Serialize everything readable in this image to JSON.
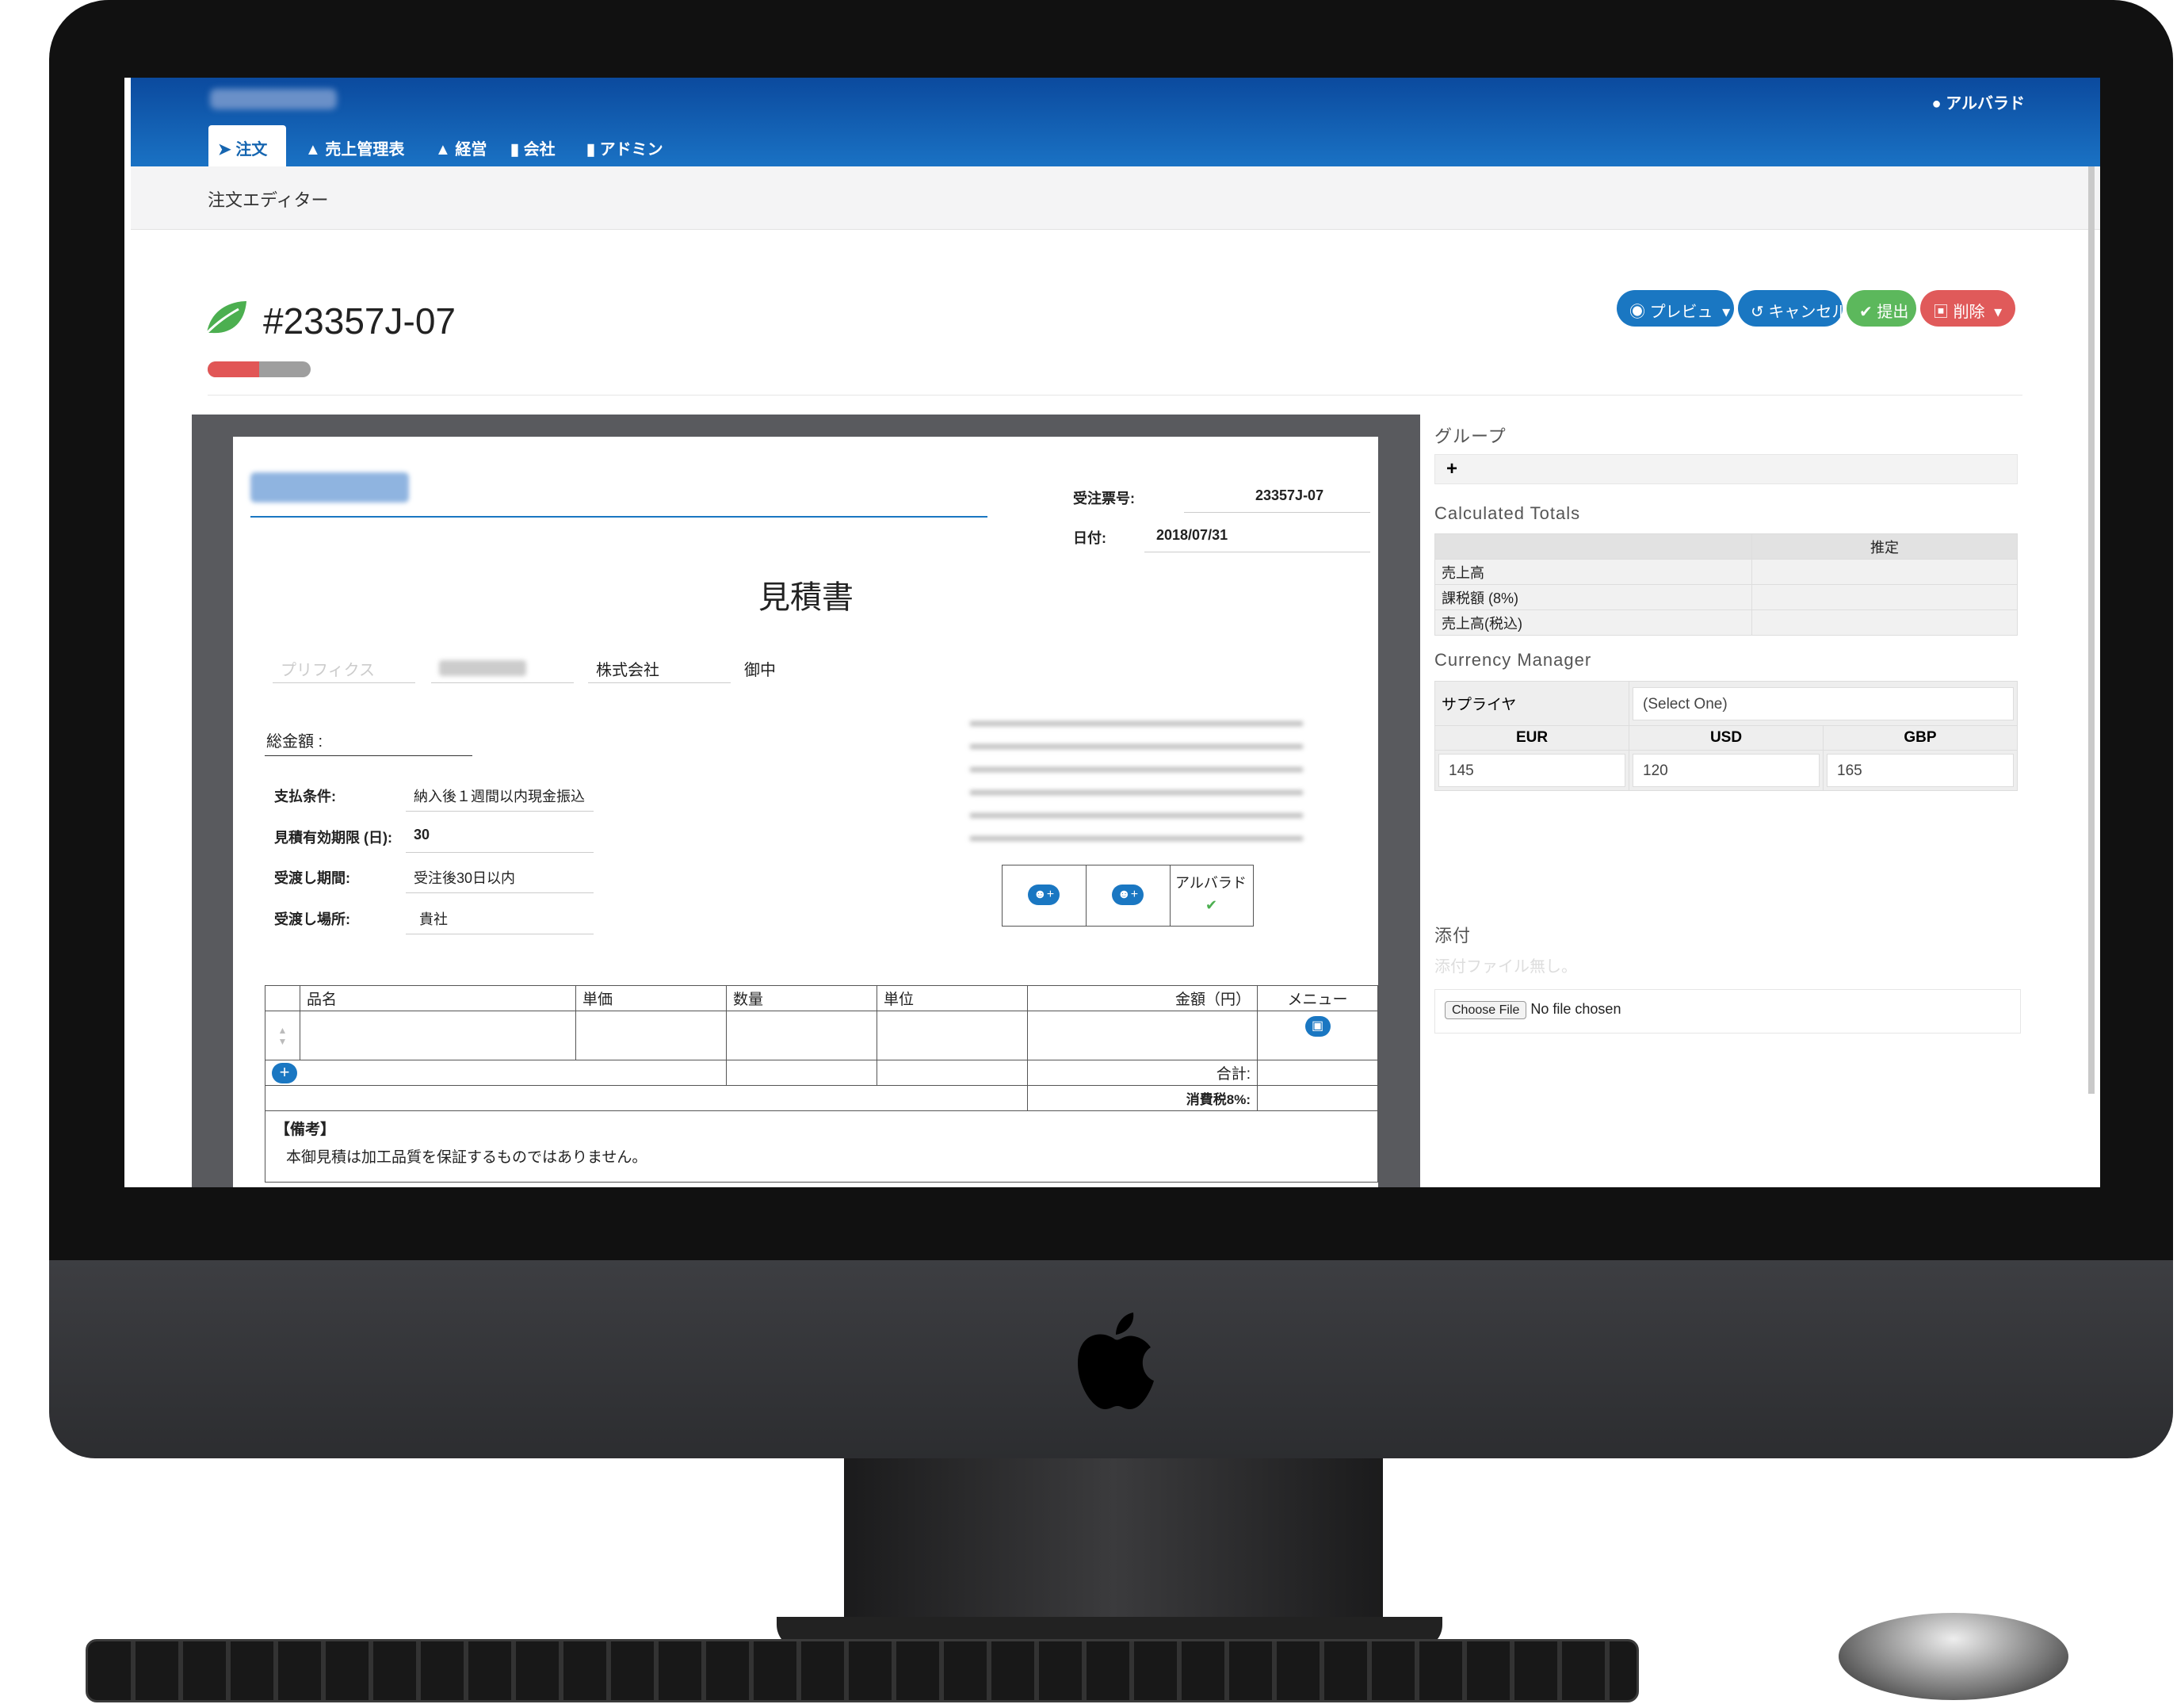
{
  "app": {
    "user": "アルバラド"
  },
  "nav": {
    "tabs": [
      {
        "label": "注文",
        "icon": "paper-plane-icon"
      },
      {
        "label": "売上管理表",
        "icon": "chart-icon"
      },
      {
        "label": "経営",
        "icon": "sitemap-icon"
      },
      {
        "label": "会社",
        "icon": "building-icon"
      },
      {
        "label": "アドミン",
        "icon": "database-icon"
      }
    ]
  },
  "breadcrumb": "注文エディター",
  "order": {
    "number": "#23357J-07",
    "progress": 0.5,
    "status_color": "#4caf50"
  },
  "actions": {
    "preview": "プレビュ",
    "cancel": "キャンセル",
    "submit": "提出",
    "delete": "削除"
  },
  "doc": {
    "order_no_label": "受注票号:",
    "order_no": "23357J-07",
    "date_label": "日付:",
    "date": "2018/07/31",
    "title": "見積書",
    "prefix_placeholder": "プリフィクス",
    "company_suffix": "株式会社",
    "honorific": "御中",
    "total_label": "総金額 :",
    "terms": [
      {
        "label": "支払条件:",
        "value": "納入後１週間以内現金振込"
      },
      {
        "label": "見積有効期限 (日):",
        "value": "30"
      },
      {
        "label": "受渡し期間:",
        "value": "受注後30日以内"
      },
      {
        "label": "受渡し場所:",
        "value": "貴社"
      }
    ],
    "approver": "アルバラド",
    "table_headers": [
      "品名",
      "単価",
      "数量",
      "単位",
      "金額（円）",
      "メニュー"
    ],
    "subtotal_label": "合計:",
    "tax_label": "消費税8%:",
    "notes_label": "【備考】",
    "notes_text": "本御見積は加工品質を保証するものではありません。"
  },
  "sidebar": {
    "group_label": "グループ",
    "add_symbol": "+",
    "calc_label": "Calculated Totals",
    "calc_header": "推定",
    "calc_rows": [
      "売上高",
      "課税額 (8%)",
      "売上高(税込)"
    ],
    "currency_label": "Currency Manager",
    "supplier_label": "サプライヤ",
    "supplier_value": "(Select One)",
    "currencies": [
      {
        "code": "EUR",
        "value": "145"
      },
      {
        "code": "USD",
        "value": "120"
      },
      {
        "code": "GBP",
        "value": "165"
      }
    ],
    "attach_label": "添付",
    "attach_empty": "添付ファイル無し。",
    "choose_file": "Choose File",
    "no_file": "No file chosen"
  },
  "colors": {
    "nav": "#1565b0",
    "btn_blue": "#1a77c2",
    "btn_green": "#5cb85c",
    "btn_red": "#e05a5a"
  }
}
